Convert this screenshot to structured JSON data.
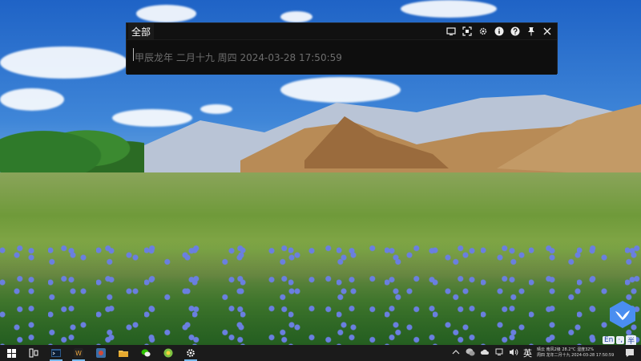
{
  "launcher": {
    "tab_all": "全部",
    "search_placeholder": "甲辰龙年 二月十九 周四 2024-03-28 17:50:59",
    "tools": [
      {
        "icon": "window-icon"
      },
      {
        "icon": "screenshot-icon"
      },
      {
        "icon": "gear-icon"
      },
      {
        "icon": "info-icon"
      },
      {
        "icon": "help-icon"
      },
      {
        "icon": "pin-icon"
      },
      {
        "icon": "close-icon"
      }
    ]
  },
  "ime": {
    "lang": "En",
    "punct": "·,",
    "mode": "半"
  },
  "taskbar": {
    "apps": [
      {
        "icon": "windows-start-icon"
      },
      {
        "icon": "task-view-icon"
      },
      {
        "icon": "terminal-icon",
        "active": true
      },
      {
        "icon": "wps-icon",
        "active": true
      },
      {
        "icon": "browser-icon"
      },
      {
        "icon": "file-explorer-icon"
      },
      {
        "icon": "wechat-icon"
      },
      {
        "icon": "app-circle-icon"
      },
      {
        "icon": "settings-gear-icon",
        "active": true
      }
    ],
    "tray": {
      "ime_label": "英",
      "clock_line1": "晴云 南风2级 28.2°C 湿度32%",
      "clock_line2": "周四 龙年二月十九 2024-03-28 17:50:59"
    }
  },
  "colors": {
    "launcher_bg": "#111111",
    "taskbar_bg": "#1b1b1b",
    "accent": "#76b9ed"
  }
}
